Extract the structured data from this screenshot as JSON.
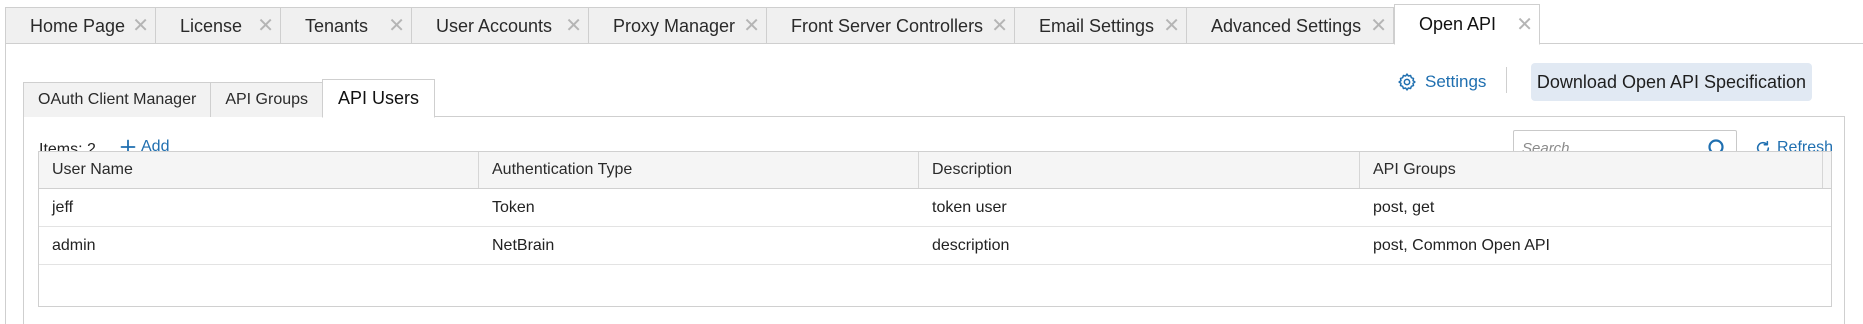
{
  "top_tabs": [
    {
      "label": "Home Page",
      "close": "✕",
      "active": false
    },
    {
      "label": "License",
      "close": "✕",
      "active": false
    },
    {
      "label": "Tenants",
      "close": "✕",
      "active": false
    },
    {
      "label": "User Accounts",
      "close": "✕",
      "active": false
    },
    {
      "label": "Proxy Manager",
      "close": "✕",
      "active": false
    },
    {
      "label": "Front Server Controllers",
      "close": "✕",
      "active": false
    },
    {
      "label": "Email Settings",
      "close": "✕",
      "active": false
    },
    {
      "label": "Advanced Settings",
      "close": "✕",
      "active": false
    },
    {
      "label": "Open API",
      "close": "✕",
      "active": true
    }
  ],
  "sub_tabs": [
    {
      "label": "OAuth Client Manager",
      "active": false
    },
    {
      "label": "API Groups",
      "active": false
    },
    {
      "label": "API Users",
      "active": true
    }
  ],
  "header": {
    "settings_label": "Settings",
    "settings_icon": "gear-icon",
    "download_label": "Download Open API Specification"
  },
  "toolbar": {
    "items_label": "Items: 2",
    "add_label": "Add",
    "add_icon": "plus-icon",
    "search_placeholder": "Search...",
    "search_icon": "search-icon",
    "refresh_label": "Refresh",
    "refresh_icon": "refresh-icon"
  },
  "table": {
    "columns": [
      "User Name",
      "Authentication Type",
      "Description",
      "API Groups"
    ],
    "rows": [
      [
        "jeff",
        "Token",
        "token user",
        "post, get"
      ],
      [
        "admin",
        "NetBrain",
        "description",
        "post, Common Open API"
      ]
    ]
  },
  "colors": {
    "link": "#1f6fb0",
    "button_bg": "#e1e9f3",
    "tab_bg": "#f0f0f0",
    "border": "#cfcfcf"
  }
}
